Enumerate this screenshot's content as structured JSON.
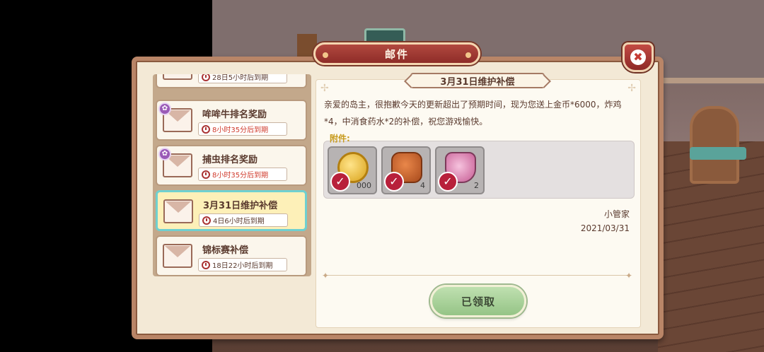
{
  "window": {
    "title": "邮件",
    "close_icon": "close-icon"
  },
  "mail_list": [
    {
      "title": "",
      "expire": "28日5小时后到期",
      "urgent": false,
      "has_gear": false,
      "selected": false
    },
    {
      "title": "哞哞牛排名奖励",
      "expire": "8小时35分后到期",
      "urgent": true,
      "has_gear": true,
      "selected": false
    },
    {
      "title": "捕虫排名奖励",
      "expire": "8小时35分后到期",
      "urgent": true,
      "has_gear": true,
      "selected": false
    },
    {
      "title": "3月31日维护补偿",
      "expire": "4日6小时后到期",
      "urgent": false,
      "has_gear": false,
      "selected": true
    },
    {
      "title": "锦标赛补偿",
      "expire": "18日22小时后到期",
      "urgent": false,
      "has_gear": false,
      "selected": false
    }
  ],
  "detail": {
    "subject": "3月31日维护补偿",
    "body": "亲爱的岛主，很抱歉今天的更新超出了预期时间，现为您送上金币*6000，炸鸡*4，中消食药水*2的补偿，祝您游戏愉快。",
    "attachments_label": "附件:",
    "attachments": [
      {
        "icon": "gold-coin-icon",
        "count": "000"
      },
      {
        "icon": "fried-chicken-icon",
        "count": "4"
      },
      {
        "icon": "digestive-potion-icon",
        "count": "2"
      }
    ],
    "signer": "小管家",
    "date": "2021/03/31",
    "claim_button": "已领取"
  },
  "colors": {
    "frame": "#b98567",
    "title_bar": "#8e2c28",
    "selected_border": "#6fd0d0",
    "claim_button": "#95c486",
    "urgent_text": "#d03a2c"
  }
}
